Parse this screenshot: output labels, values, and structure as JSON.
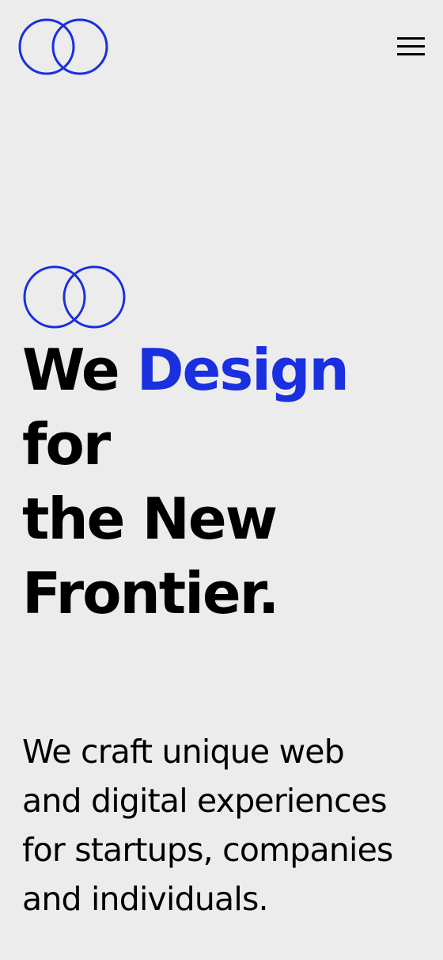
{
  "colors": {
    "background": "#ececec",
    "accent": "#1a2fe0",
    "text": "#000000"
  },
  "header": {
    "logo_icon": "interlocking-rings-logo",
    "menu_icon": "hamburger-menu-icon"
  },
  "hero": {
    "mark_icon": "interlocking-rings-mark",
    "headline": {
      "line1_word1": "We",
      "line1_accent": "Design",
      "line2": "for",
      "line3": "the New",
      "line4": "Frontier."
    },
    "description": {
      "line1": "We craft unique web",
      "line2": "and digital experiences",
      "line3": "for startups, companies",
      "line4": "and individuals."
    }
  }
}
